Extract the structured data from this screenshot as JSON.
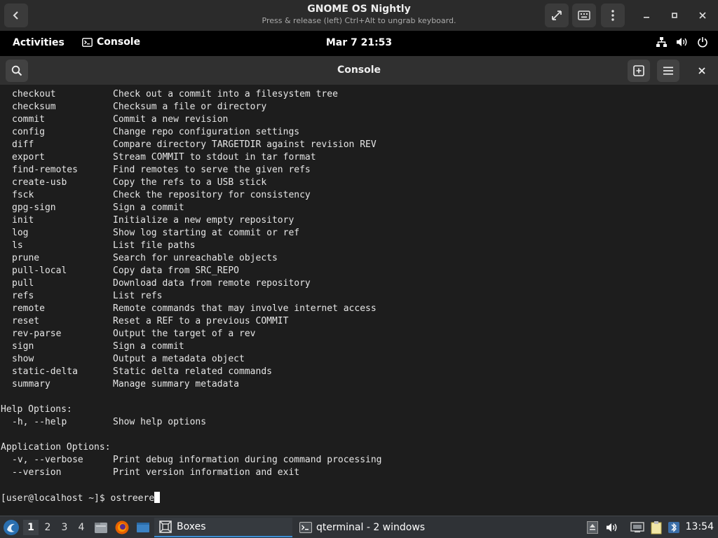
{
  "vm_window": {
    "title": "GNOME OS Nightly",
    "subtitle": "Press & release (left) Ctrl+Alt to ungrab keyboard.",
    "icons": [
      "back-icon",
      "fullscreen-icon",
      "keyboard-icon",
      "menu-icon",
      "minimize-icon",
      "maximize-icon",
      "close-icon"
    ]
  },
  "gnome_topbar": {
    "activities": "Activities",
    "app_name": "Console",
    "clock": "Mar 7  21:53",
    "status_icons": [
      "network-icon",
      "volume-icon",
      "power-icon"
    ]
  },
  "console": {
    "title": "Console",
    "commands": [
      {
        "cmd": "checkout",
        "desc": "Check out a commit into a filesystem tree"
      },
      {
        "cmd": "checksum",
        "desc": "Checksum a file or directory"
      },
      {
        "cmd": "commit",
        "desc": "Commit a new revision"
      },
      {
        "cmd": "config",
        "desc": "Change repo configuration settings"
      },
      {
        "cmd": "diff",
        "desc": "Compare directory TARGETDIR against revision REV"
      },
      {
        "cmd": "export",
        "desc": "Stream COMMIT to stdout in tar format"
      },
      {
        "cmd": "find-remotes",
        "desc": "Find remotes to serve the given refs"
      },
      {
        "cmd": "create-usb",
        "desc": "Copy the refs to a USB stick"
      },
      {
        "cmd": "fsck",
        "desc": "Check the repository for consistency"
      },
      {
        "cmd": "gpg-sign",
        "desc": "Sign a commit"
      },
      {
        "cmd": "init",
        "desc": "Initialize a new empty repository"
      },
      {
        "cmd": "log",
        "desc": "Show log starting at commit or ref"
      },
      {
        "cmd": "ls",
        "desc": "List file paths"
      },
      {
        "cmd": "prune",
        "desc": "Search for unreachable objects"
      },
      {
        "cmd": "pull-local",
        "desc": "Copy data from SRC_REPO"
      },
      {
        "cmd": "pull",
        "desc": "Download data from remote repository"
      },
      {
        "cmd": "refs",
        "desc": "List refs"
      },
      {
        "cmd": "remote",
        "desc": "Remote commands that may involve internet access"
      },
      {
        "cmd": "reset",
        "desc": "Reset a REF to a previous COMMIT"
      },
      {
        "cmd": "rev-parse",
        "desc": "Output the target of a rev"
      },
      {
        "cmd": "sign",
        "desc": "Sign a commit"
      },
      {
        "cmd": "show",
        "desc": "Output a metadata object"
      },
      {
        "cmd": "static-delta",
        "desc": "Static delta related commands"
      },
      {
        "cmd": "summary",
        "desc": "Manage summary metadata"
      }
    ],
    "help_header": "Help Options:",
    "help_options": [
      {
        "cmd": "-h, --help",
        "desc": "Show help options"
      }
    ],
    "app_header": "Application Options:",
    "app_options": [
      {
        "cmd": "-v, --verbose",
        "desc": "Print debug information during command processing"
      },
      {
        "cmd": "--version",
        "desc": "Print version information and exit"
      }
    ],
    "prompt": "[user@localhost ~]$ ",
    "input": "ostreere"
  },
  "taskbar": {
    "workspaces": [
      "1",
      "2",
      "3",
      "4"
    ],
    "active_workspace": "1",
    "tasks": [
      {
        "label": "Boxes",
        "icon": "boxes-icon",
        "active": true
      },
      {
        "label": "qterminal - 2 windows",
        "icon": "terminal-icon",
        "active": false
      }
    ],
    "clock": "13:54",
    "colors": {
      "accent": "#3d8fd6",
      "bar": "#2f3236"
    }
  }
}
